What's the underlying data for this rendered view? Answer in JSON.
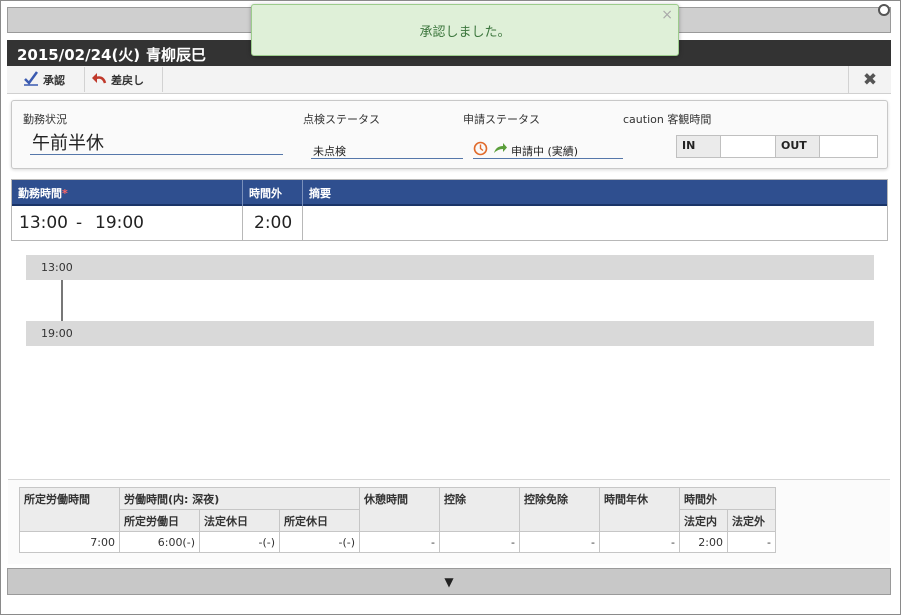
{
  "toast": {
    "message": "承認しました。",
    "close": "×"
  },
  "header": {
    "date": "2015/02/24(火)",
    "name": "青柳辰巳"
  },
  "toolbar": {
    "approve_label": "承認",
    "reject_label": "差戻し",
    "close_icon": "close-icon",
    "approve_icon": "approve-check-icon",
    "reject_icon": "undo-arrow-icon"
  },
  "status": {
    "attendance_label": "勤務状況",
    "attendance_value": "午前半休",
    "check_label": "点検ステータス",
    "check_value": "未点検",
    "apply_label": "申請ステータス",
    "apply_value": "申請中 (実績)",
    "caution_label": "caution 客観時間",
    "in_label": "IN",
    "in_value": "",
    "out_label": "OUT",
    "out_value": ""
  },
  "work_table": {
    "headers": {
      "hours": "勤務時間",
      "required_mark": "*",
      "overtime": "時間外",
      "summary": "摘要"
    },
    "start": "13:00",
    "separator": "-",
    "end": "19:00",
    "overtime": "2:00",
    "summary": ""
  },
  "timeline": {
    "start_label": "13:00",
    "end_label": "19:00"
  },
  "summary_table": {
    "headers": {
      "scheduled_hours": "所定労働時間",
      "work_hours": "労働時間(内: 深夜)",
      "scheduled_workday": "所定労働日",
      "legal_holiday": "法定休日",
      "scheduled_holiday": "所定休日",
      "break_time": "休憩時間",
      "deduction": "控除",
      "deduction_exempt": "控除免除",
      "hourly_leave": "時間年休",
      "overtime": "時間外",
      "legal_in": "法定内",
      "legal_out": "法定外"
    },
    "values": {
      "scheduled_hours": "7:00",
      "scheduled_workday": "6:00(-)",
      "legal_holiday": "-(-)",
      "scheduled_holiday": "-(-)",
      "break_time": "-",
      "deduction": "-",
      "deduction_exempt": "-",
      "hourly_leave": "-",
      "legal_in": "2:00",
      "legal_out": "-"
    }
  },
  "bottom": {
    "expand": "▼"
  },
  "colors": {
    "header_bg": "#333333",
    "table_head_bg": "#2f4f8f",
    "toast_bg": "#dff0d8",
    "toast_text": "#3c763d",
    "apply_icon_orange": "#e06a2b",
    "apply_icon_green": "#5a9e3a"
  }
}
